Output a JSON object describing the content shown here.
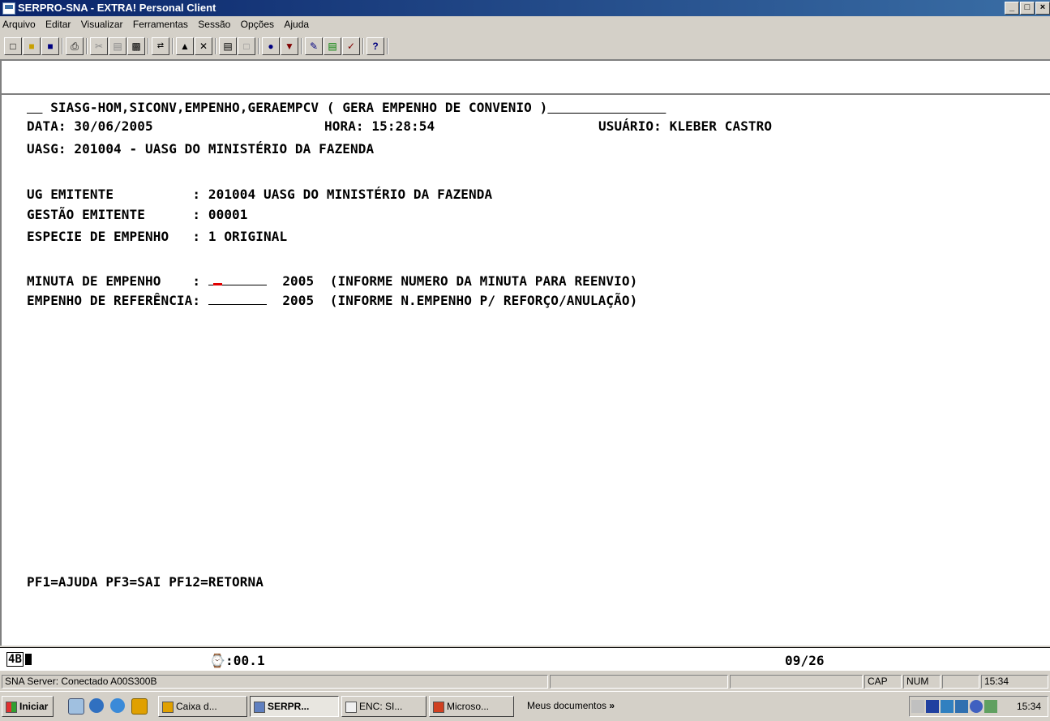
{
  "window": {
    "title": "SERPRO-SNA - EXTRA! Personal Client",
    "buttons": [
      "_",
      "□",
      "×"
    ]
  },
  "menu": [
    "Arquivo",
    "Editar",
    "Visualizar",
    "Ferramentas",
    "Sessão",
    "Opções",
    "Ajuda"
  ],
  "toolbar": [
    "new-icon",
    "open-icon",
    "save-icon",
    "print-icon",
    "cut-icon",
    "copy-icon",
    "paste-icon",
    "connect-icon",
    "send-icon",
    "tools-icon",
    "printer-setup-icon",
    "blank-icon",
    "record-icon",
    "macro-icon",
    "edit-macro-icon",
    "chart-icon",
    "check-icon",
    "help-icon"
  ],
  "terminal": {
    "title_line": "SIASG-HOM,SICONV,EMPENHO,GERAEMPCV ( GERA EMPENHO DE CONVENIO )",
    "data_label": "DATA: 30/06/2005",
    "hora_label": "HORA: 15:28:54",
    "usuario_label": "USUÁRIO: KLEBER CASTRO",
    "uasg_line": "UASG: 201004 - UASG DO MINISTÉRIO DA FAZENDA",
    "ug_emitente": "UG EMITENTE          : 201004 UASG DO MINISTÉRIO DA FAZENDA",
    "gestao_emitente": "GESTÃO EMITENTE      : 00001",
    "especie_empenho": "ESPECIE DE EMPENHO   : 1 ORIGINAL",
    "minuta_label": "MINUTA DE EMPENHO    : ",
    "minuta_value": "",
    "minuta_year": "2005",
    "minuta_hint": "(INFORME NUMERO DA MINUTA PARA REENVIO)",
    "referencia_label": "EMPENHO DE REFERÊNCIA: ",
    "referencia_value": "",
    "referencia_year": "2005",
    "referencia_hint": "(INFORME N.EMPENHO P/ REFORÇO/ANULAÇÃO)",
    "pf_keys": "PF1=AJUDA PF3=SAI PF12=RETORNA"
  },
  "oia": {
    "indicator": "4B",
    "timer": ":00.1",
    "cursor_pos": "09/26"
  },
  "status": {
    "server": "SNA Server: Conectado A00S300B",
    "cap": "CAP",
    "num": "NUM",
    "time": "15:34"
  },
  "taskbar": {
    "start": "Iniciar",
    "tasks": [
      "Caixa d...",
      "SERPR...",
      "ENC: SI...",
      "Microso..."
    ],
    "address": "Meus documentos",
    "clock": "15:34"
  }
}
